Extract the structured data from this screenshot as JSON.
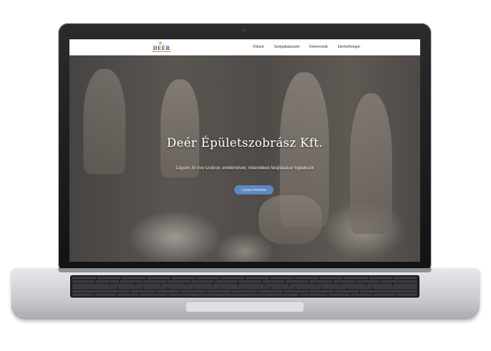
{
  "nav": {
    "logo_text": "DEÉR",
    "links": [
      "Rólunk",
      "Szolgáltatásaink",
      "Referenciák",
      "Elérhetőségek"
    ]
  },
  "hero": {
    "title": "Deér Épületszobrász Kft.",
    "subtitle": "Cégünk 30 éve szobrok, emlékművek, műemlékek felújításával foglalkozik",
    "cta_label": "AJÁNLATKÉRÉS"
  },
  "colors": {
    "cta_bg": "#5d88c4",
    "logo_text": "#3b4d7a",
    "logo_star": "#d4a52a"
  }
}
